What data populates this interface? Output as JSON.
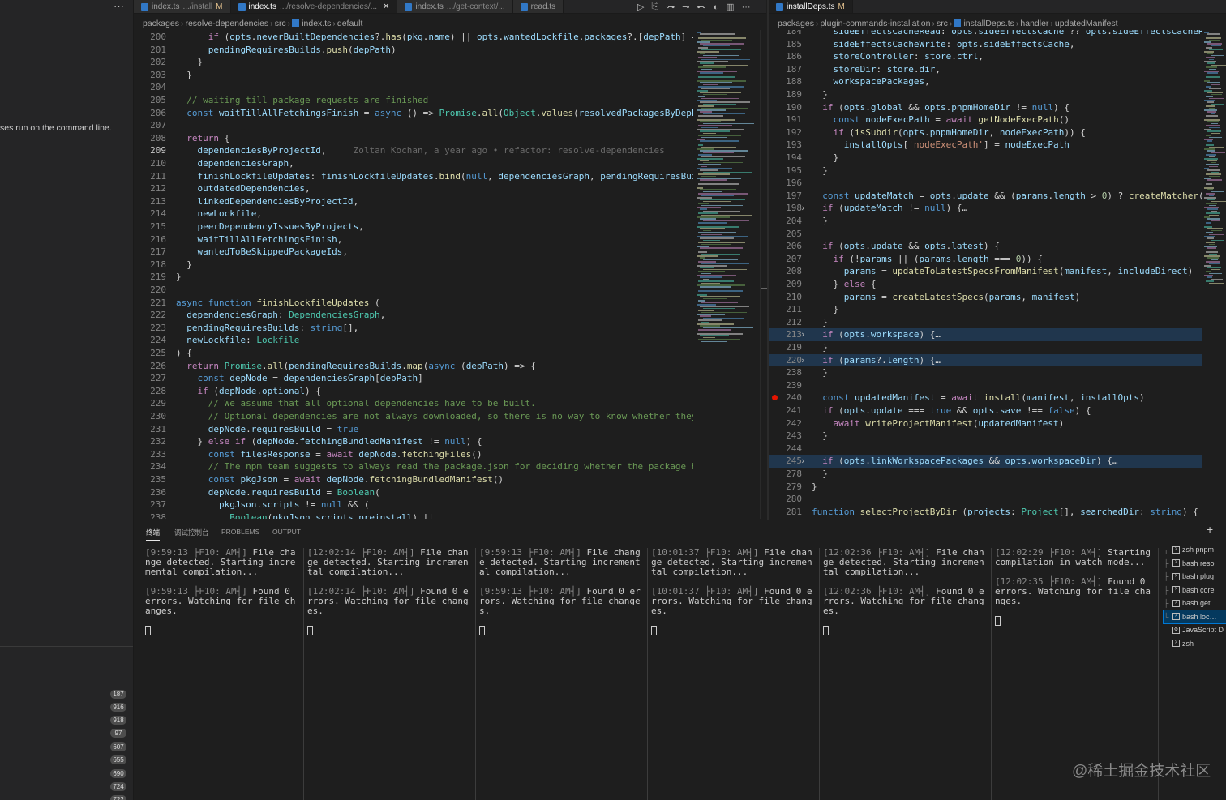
{
  "sidebar": {
    "desc": "ses run on the command line.",
    "badges": [
      "187",
      "916",
      "918",
      "97",
      "607",
      "655",
      "690",
      "724",
      "722"
    ]
  },
  "left_tabs": [
    {
      "name": "index.ts",
      "sub": ".../install",
      "mod": "M",
      "active": false
    },
    {
      "name": "index.ts",
      "sub": ".../resolve-dependencies/...",
      "mod": "",
      "active": true,
      "close": "✕"
    },
    {
      "name": "index.ts",
      "sub": ".../get-context/...",
      "mod": "",
      "active": false
    },
    {
      "name": "read.ts",
      "sub": "",
      "mod": "",
      "active": false
    }
  ],
  "right_tabs": [
    {
      "name": "installDeps.ts",
      "sub": "",
      "mod": "M",
      "active": true
    }
  ],
  "left_breadcrumb": [
    "packages",
    "resolve-dependencies",
    "src",
    "index.ts",
    "default"
  ],
  "right_breadcrumb": [
    "packages",
    "plugin-commands-installation",
    "src",
    "installDeps.ts",
    "handler",
    "updatedManifest"
  ],
  "left_lines": [
    {
      "n": "200",
      "t": "      if (opts.neverBuiltDependencies?.has(pkg.name) || opts.wantedLockfile.packages?.[depPath] == nu"
    },
    {
      "n": "201",
      "t": "      pendingRequiresBuilds.push(depPath)"
    },
    {
      "n": "202",
      "t": "    }"
    },
    {
      "n": "203",
      "t": "  }"
    },
    {
      "n": "204",
      "t": ""
    },
    {
      "n": "205",
      "t": "  // waiting till package requests are finished"
    },
    {
      "n": "206",
      "t": "  const waitTillAllFetchingsFinish = async () => Promise.all(Object.values(resolvedPackagesByDepPath)"
    },
    {
      "n": "207",
      "t": ""
    },
    {
      "n": "208",
      "t": "  return {"
    },
    {
      "n": "209",
      "t": "    dependenciesByProjectId,",
      "blame": "Zoltan Kochan, a year ago • refactor: resolve-dependencies"
    },
    {
      "n": "210",
      "t": "    dependenciesGraph,"
    },
    {
      "n": "211",
      "t": "    finishLockfileUpdates: finishLockfileUpdates.bind(null, dependenciesGraph, pendingRequiresBuilds,"
    },
    {
      "n": "212",
      "t": "    outdatedDependencies,"
    },
    {
      "n": "213",
      "t": "    linkedDependenciesByProjectId,"
    },
    {
      "n": "214",
      "t": "    newLockfile,"
    },
    {
      "n": "215",
      "t": "    peerDependencyIssuesByProjects,"
    },
    {
      "n": "216",
      "t": "    waitTillAllFetchingsFinish,"
    },
    {
      "n": "217",
      "t": "    wantedToBeSkippedPackageIds,"
    },
    {
      "n": "218",
      "t": "  }"
    },
    {
      "n": "219",
      "t": "}"
    },
    {
      "n": "220",
      "t": ""
    },
    {
      "n": "221",
      "t": "async function finishLockfileUpdates ("
    },
    {
      "n": "222",
      "t": "  dependenciesGraph: DependenciesGraph,"
    },
    {
      "n": "223",
      "t": "  pendingRequiresBuilds: string[],"
    },
    {
      "n": "224",
      "t": "  newLockfile: Lockfile"
    },
    {
      "n": "225",
      "t": ") {"
    },
    {
      "n": "226",
      "t": "  return Promise.all(pendingRequiresBuilds.map(async (depPath) => {"
    },
    {
      "n": "227",
      "t": "    const depNode = dependenciesGraph[depPath]"
    },
    {
      "n": "228",
      "t": "    if (depNode.optional) {"
    },
    {
      "n": "229",
      "t": "      // We assume that all optional dependencies have to be built."
    },
    {
      "n": "230",
      "t": "      // Optional dependencies are not always downloaded, so there is no way to know whether they nee"
    },
    {
      "n": "231",
      "t": "      depNode.requiresBuild = true"
    },
    {
      "n": "232",
      "t": "    } else if (depNode.fetchingBundledManifest != null) {"
    },
    {
      "n": "233",
      "t": "      const filesResponse = await depNode.fetchingFiles()"
    },
    {
      "n": "234",
      "t": "      // The npm team suggests to always read the package.json for deciding whether the package has l"
    },
    {
      "n": "235",
      "t": "      const pkgJson = await depNode.fetchingBundledManifest()"
    },
    {
      "n": "236",
      "t": "      depNode.requiresBuild = Boolean("
    },
    {
      "n": "237",
      "t": "        pkgJson.scripts != null && ("
    },
    {
      "n": "238",
      "t": "          Boolean(pkgJson.scripts.preinstall) ||"
    }
  ],
  "right_lines": [
    {
      "n": "184",
      "t": "    sideEffectsCacheRead: opts.sideEffectsCache ?? opts.sideEffectsCacheRead,"
    },
    {
      "n": "185",
      "t": "    sideEffectsCacheWrite: opts.sideEffectsCache,"
    },
    {
      "n": "186",
      "t": "    storeController: store.ctrl,"
    },
    {
      "n": "187",
      "t": "    storeDir: store.dir,"
    },
    {
      "n": "188",
      "t": "    workspacePackages,"
    },
    {
      "n": "189",
      "t": "  }"
    },
    {
      "n": "190",
      "t": "  if (opts.global && opts.pnpmHomeDir != null) {"
    },
    {
      "n": "191",
      "t": "    const nodeExecPath = await getNodeExecPath()"
    },
    {
      "n": "192",
      "t": "    if (isSubdir(opts.pnpmHomeDir, nodeExecPath)) {"
    },
    {
      "n": "193",
      "t": "      installOpts['nodeExecPath'] = nodeExecPath"
    },
    {
      "n": "194",
      "t": "    }"
    },
    {
      "n": "195",
      "t": "  }"
    },
    {
      "n": "196",
      "t": ""
    },
    {
      "n": "197",
      "t": "  const updateMatch = opts.update && (params.length > 0) ? createMatcher(para"
    },
    {
      "n": "198",
      "t": "  if (updateMatch != null) {…",
      "fold": true
    },
    {
      "n": "204",
      "t": "  }"
    },
    {
      "n": "205",
      "t": ""
    },
    {
      "n": "206",
      "t": "  if (opts.update && opts.latest) {"
    },
    {
      "n": "207",
      "t": "    if (!params || (params.length === 0)) {"
    },
    {
      "n": "208",
      "t": "      params = updateToLatestSpecsFromManifest(manifest, includeDirect)"
    },
    {
      "n": "209",
      "t": "    } else {"
    },
    {
      "n": "210",
      "t": "      params = createLatestSpecs(params, manifest)"
    },
    {
      "n": "211",
      "t": "    }"
    },
    {
      "n": "212",
      "t": "  }"
    },
    {
      "n": "213",
      "t": "  if (opts.workspace) {…",
      "fold": true,
      "hl": true
    },
    {
      "n": "219",
      "t": "  }"
    },
    {
      "n": "220",
      "t": "  if (params?.length) {…",
      "fold": true,
      "hl": true
    },
    {
      "n": "238",
      "t": "  }"
    },
    {
      "n": "239",
      "t": ""
    },
    {
      "n": "240",
      "t": "  const updatedManifest = await install(manifest, installOpts)",
      "bp": true
    },
    {
      "n": "241",
      "t": "  if (opts.update === true && opts.save !== false) {"
    },
    {
      "n": "242",
      "t": "    await writeProjectManifest(updatedManifest)"
    },
    {
      "n": "243",
      "t": "  }"
    },
    {
      "n": "244",
      "t": ""
    },
    {
      "n": "245",
      "t": "  if (opts.linkWorkspacePackages && opts.workspaceDir) {…",
      "fold": true,
      "hl": true
    },
    {
      "n": "278",
      "t": "  }"
    },
    {
      "n": "279",
      "t": "}"
    },
    {
      "n": "280",
      "t": ""
    },
    {
      "n": "281",
      "t": "function selectProjectByDir (projects: Project[], searchedDir: string) {"
    }
  ],
  "panel": {
    "tabs": [
      "终端",
      "调试控制台",
      "PROBLEMS",
      "OUTPUT"
    ],
    "plus": "+",
    "terminals": [
      {
        "a_time": "[9:59:13 ├F10: AM┤]",
        "a_msg": " File change detected. Starting incremental compilation...",
        "b_time": "[9:59:13 ├F10: AM┤]",
        "b_msg": " Found 0 errors. Watching for file changes."
      },
      {
        "a_time": "[12:02:14 ├F10: AM┤]",
        "a_msg": " File change detected. Starting incremental compilation...",
        "b_time": "[12:02:14 ├F10: AM┤]",
        "b_msg": " Found 0 errors. Watching for file changes."
      },
      {
        "a_time": "[9:59:13 ├F10: AM┤]",
        "a_msg": " File change detected. Starting incremental compilation...",
        "b_time": "[9:59:13 ├F10: AM┤]",
        "b_msg": " Found 0 errors. Watching for file changes."
      },
      {
        "a_time": "[10:01:37 ├F10: AM┤]",
        "a_msg": " File change detected. Starting incremental compilation...",
        "b_time": "[10:01:37 ├F10: AM┤]",
        "b_msg": " Found 0 errors. Watching for file changes."
      },
      {
        "a_time": "[12:02:36 ├F10: AM┤]",
        "a_msg": " File change detected. Starting incremental compilation...",
        "b_time": "[12:02:36 ├F10: AM┤]",
        "b_msg": " Found 0 errors. Watching for file changes."
      },
      {
        "a_time": "[12:02:29 ├F10: AM┤]",
        "a_msg": " Starting compilation in watch mode...",
        "b_time": "[12:02:35 ├F10: AM┤]",
        "b_msg": " Found 0 errors. Watching for file changes."
      }
    ],
    "terminal_list": [
      {
        "prefix": "┌",
        "label": "zsh pnpm"
      },
      {
        "prefix": "├",
        "label": "bash reso"
      },
      {
        "prefix": "├",
        "label": "bash plug"
      },
      {
        "prefix": "├",
        "label": "bash core"
      },
      {
        "prefix": "├",
        "label": "bash get"
      },
      {
        "prefix": "└",
        "label": "bash loc…",
        "selected": true
      },
      {
        "prefix": "",
        "label": "JavaScript D"
      },
      {
        "prefix": "",
        "label": "zsh"
      }
    ]
  },
  "watermark": "@稀土掘金技术社区",
  "colors": {
    "accent": "#0078d4",
    "breakpoint": "#e51400",
    "ts": "#3178c6"
  }
}
